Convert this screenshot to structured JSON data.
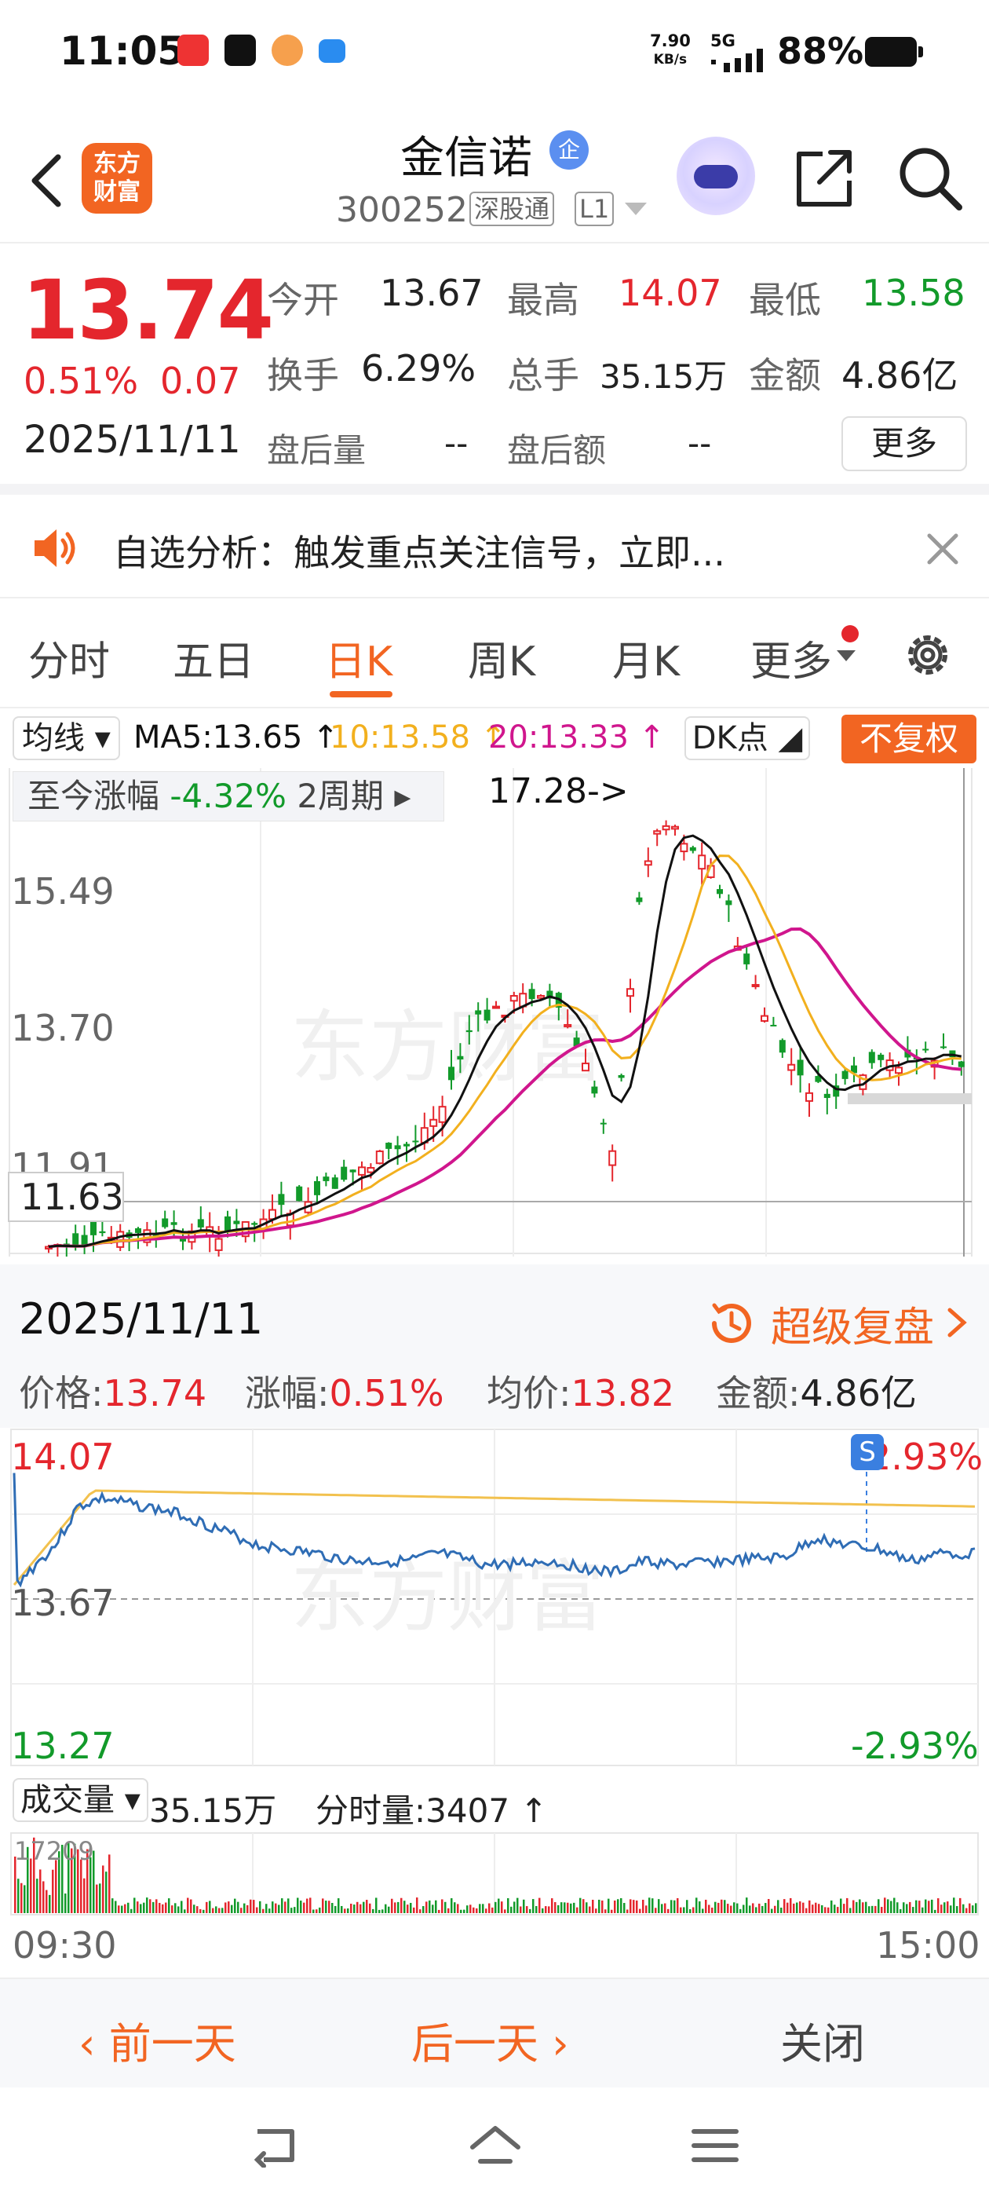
{
  "status_bar": {
    "time": "11:05",
    "net_speed_value": "7.90",
    "net_speed_unit": "KB/s",
    "network": "5G",
    "battery": "88%"
  },
  "header": {
    "app_logo_line1": "东方",
    "app_logo_line2": "财富",
    "stock_name": "金信诺",
    "enterprise_badge": "企",
    "stock_code": "300252",
    "tag_connect": "深股通",
    "tag_level": "L1"
  },
  "quote": {
    "price": "13.74",
    "change_pct": "0.51%",
    "change_amt": "0.07",
    "date": "2025/11/11",
    "open_label": "今开",
    "open": "13.67",
    "high_label": "最高",
    "high": "14.07",
    "low_label": "最低",
    "low": "13.58",
    "turnover_label": "换手",
    "turnover": "6.29%",
    "volume_label": "总手",
    "volume": "35.15万",
    "amount_label": "金额",
    "amount": "4.86亿",
    "after_vol_label": "盘后量",
    "after_vol": "--",
    "after_amt_label": "盘后额",
    "after_amt": "--",
    "more_label": "更多"
  },
  "notice": {
    "text": "自选分析：触发重点关注信号，立即..."
  },
  "tabs": [
    "分时",
    "五日",
    "日K",
    "周K",
    "月K",
    "更多"
  ],
  "active_tab": "日K",
  "ma_bar": {
    "selector": "均线",
    "ma5": "MA5:13.65",
    "ma10": "10:13.58",
    "ma20": "20:13.33",
    "dk_label": "DK点",
    "fq_label": "不复权",
    "colors": {
      "ma5": "#111111",
      "ma10": "#f2b01e",
      "ma20": "#d0168d",
      "up": "#e4262d",
      "down": "#129a2a"
    }
  },
  "kline": {
    "gain_label": "至今涨幅",
    "gain_value": "-4.32%",
    "period": "2周期",
    "peak_note": "17.28->",
    "y_labels": [
      "15.49",
      "13.70",
      "11.91"
    ],
    "crosshair_price": "11.63",
    "watermark": "东方财富"
  },
  "detail": {
    "date": "2025/11/11",
    "super_replay": "超级复盘",
    "price_label": "价格:",
    "price": "13.74",
    "pct_label": "涨幅:",
    "pct": "0.51%",
    "avg_label": "均价:",
    "avg": "13.82",
    "amount_label": "金额:",
    "amount": "4.86亿"
  },
  "intraday": {
    "top_price": "14.07",
    "mid_price": "13.67",
    "bottom_price": "13.27",
    "top_pct": "2.93%",
    "bottom_pct": "-2.93%",
    "s_badge": "S"
  },
  "volume": {
    "selector": "成交量",
    "total": "35.15万",
    "minute_label": "分时量:",
    "minute_value": "3407",
    "scale": "17209",
    "start_time": "09:30",
    "end_time": "15:00"
  },
  "nav": {
    "prev_day": "前一天",
    "next_day": "后一天",
    "close": "关闭"
  }
}
